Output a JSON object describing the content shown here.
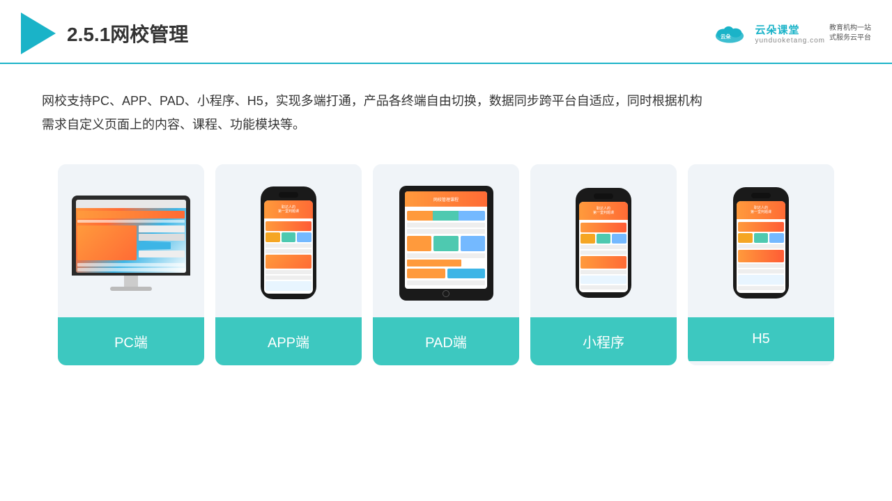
{
  "header": {
    "title": "2.5.1网校管理",
    "logo_main": "云朵课堂",
    "logo_url": "yunduoketang.com",
    "logo_tagline": "教育机构一站\n式服务云平台"
  },
  "description": {
    "text": "网校支持PC、APP、PAD、小程序、H5，实现多端打通，产品各终端自由切换，数据同步跨平台自适应，同时根据机构需求自定义页面上的内容、课程、功能模块等。"
  },
  "cards": [
    {
      "id": "pc",
      "label": "PC端"
    },
    {
      "id": "app",
      "label": "APP端"
    },
    {
      "id": "pad",
      "label": "PAD端"
    },
    {
      "id": "mini",
      "label": "小程序"
    },
    {
      "id": "h5",
      "label": "H5"
    }
  ]
}
